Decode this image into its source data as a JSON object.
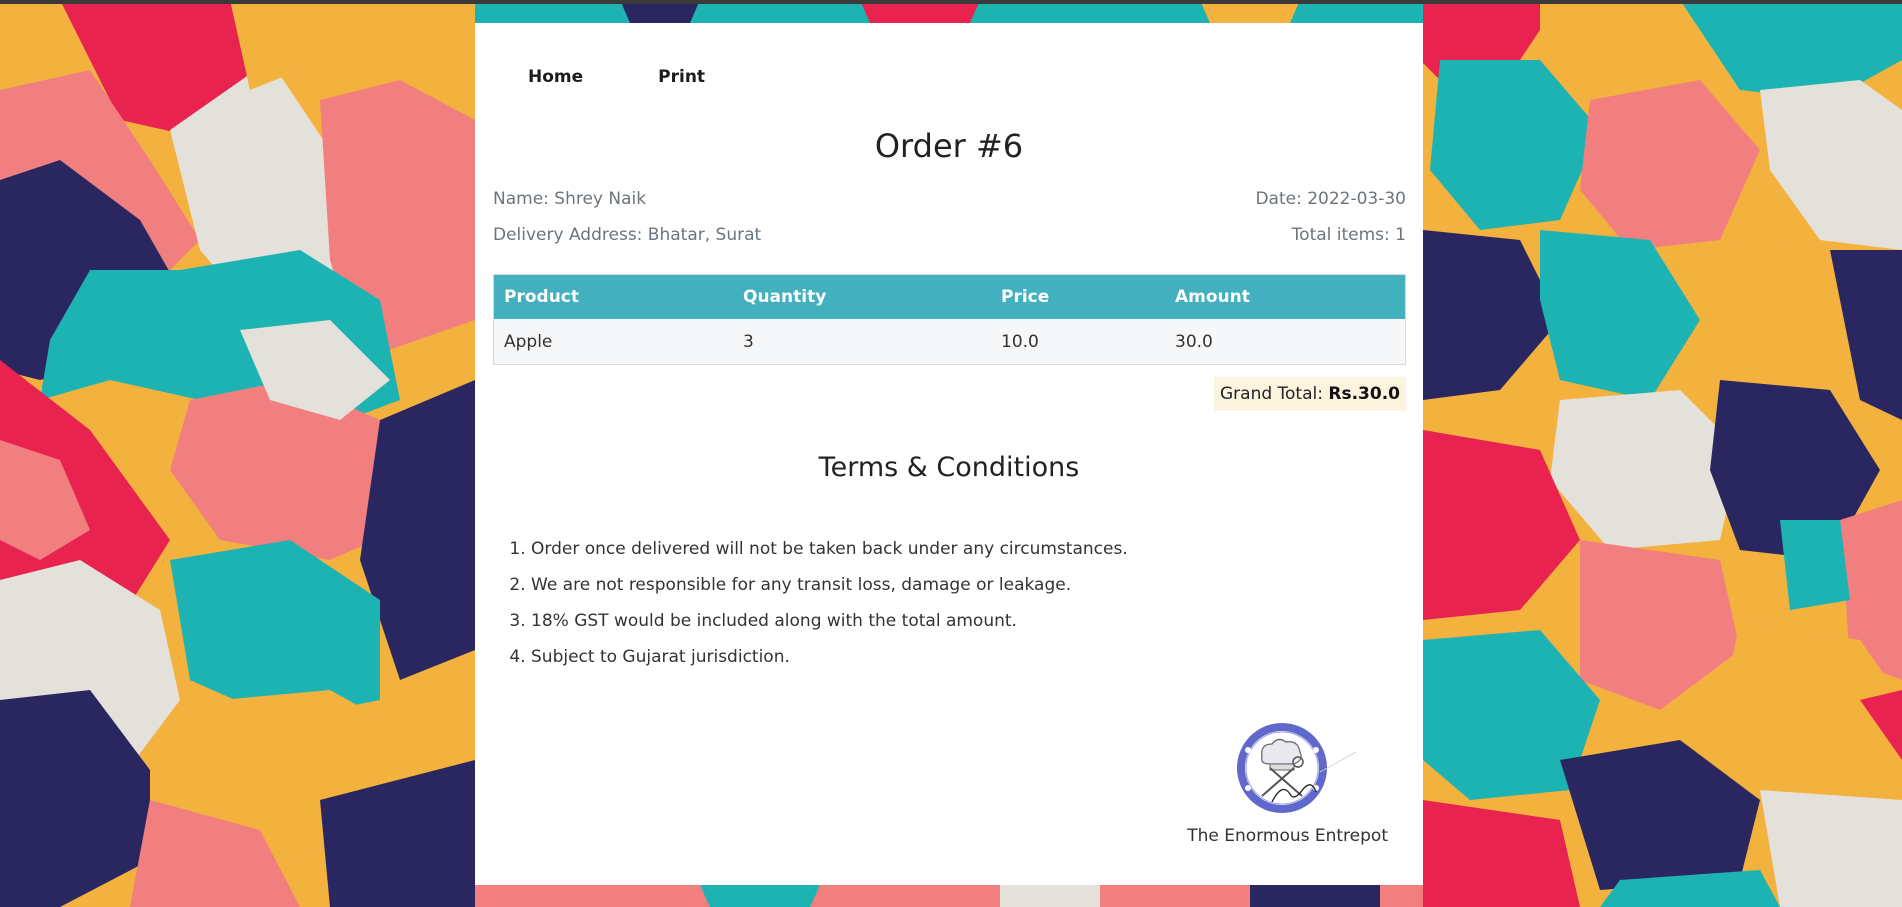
{
  "nav": {
    "home": "Home",
    "print": "Print"
  },
  "order": {
    "title": "Order #6",
    "name": "Name: Shrey Naik",
    "address": "Delivery Address: Bhatar, Surat",
    "date": "Date: 2022-03-30",
    "total_items": "Total items: 1"
  },
  "table": {
    "headers": [
      "Product",
      "Quantity",
      "Price",
      "Amount"
    ],
    "rows": [
      [
        "Apple",
        "3",
        "10.0",
        "30.0"
      ]
    ]
  },
  "grand_total": {
    "label": "Grand Total: ",
    "value": "Rs.30.0"
  },
  "terms": {
    "title": "Terms & Conditions",
    "items": [
      "Order once delivered will not be taken back under any circumstances.",
      "We are not responsible for any transit loss, damage or leakage.",
      "18% GST would be included along with the total amount.",
      "Subject to Gujarat jurisdiction."
    ]
  },
  "footer": {
    "brand": "The Enormous Entrepot"
  },
  "colors": {
    "table_header": "#42b0bf",
    "grand_total_bg": "#fdf4e0",
    "logo_ring": "#5a64c8",
    "bg_palette": [
      "#f3b13e",
      "#e8234f",
      "#1db3b3",
      "#f27f7f",
      "#e4e1da",
      "#2a2760"
    ]
  },
  "icons": {
    "logo": "chef-hat-utensils-seal-icon"
  }
}
